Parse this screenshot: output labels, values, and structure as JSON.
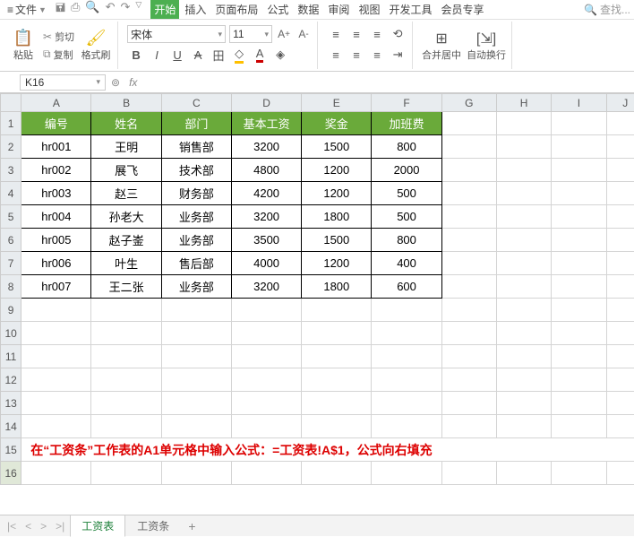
{
  "menubar": {
    "file": "文件",
    "tabs": [
      "开始",
      "插入",
      "页面布局",
      "公式",
      "数据",
      "审阅",
      "视图",
      "开发工具",
      "会员专享"
    ],
    "active_tab": 0,
    "search_placeholder": "查找..."
  },
  "ribbon": {
    "paste": "粘贴",
    "cut": "剪切",
    "copy": "复制",
    "format_painter": "格式刷",
    "font_name": "宋体",
    "font_size": "11",
    "merge_center": "合并居中",
    "wrap": "自动换行"
  },
  "namebox": "K16",
  "formula": "",
  "columns": [
    "A",
    "B",
    "C",
    "D",
    "E",
    "F",
    "G",
    "H",
    "I",
    "J"
  ],
  "rows": [
    "1",
    "2",
    "3",
    "4",
    "5",
    "6",
    "7",
    "8",
    "9",
    "10",
    "11",
    "12",
    "13",
    "14",
    "15",
    "16"
  ],
  "headers": [
    "编号",
    "姓名",
    "部门",
    "基本工资",
    "奖金",
    "加班费"
  ],
  "data": [
    [
      "hr001",
      "王明",
      "销售部",
      "3200",
      "1500",
      "800"
    ],
    [
      "hr002",
      "展飞",
      "技术部",
      "4800",
      "1200",
      "2000"
    ],
    [
      "hr003",
      "赵三",
      "财务部",
      "4200",
      "1200",
      "500"
    ],
    [
      "hr004",
      "孙老大",
      "业务部",
      "3200",
      "1800",
      "500"
    ],
    [
      "hr005",
      "赵子崟",
      "业务部",
      "3500",
      "1500",
      "800"
    ],
    [
      "hr006",
      "叶生",
      "售后部",
      "4000",
      "1200",
      "400"
    ],
    [
      "hr007",
      "王二张",
      "业务部",
      "3200",
      "1800",
      "600"
    ]
  ],
  "annotation": "在“工资条”工作表的A1单元格中输入公式：=工资表!A$1，公式向右填充",
  "sheets": {
    "items": [
      "工资表",
      "工资条"
    ],
    "active": 0,
    "add": "+"
  }
}
